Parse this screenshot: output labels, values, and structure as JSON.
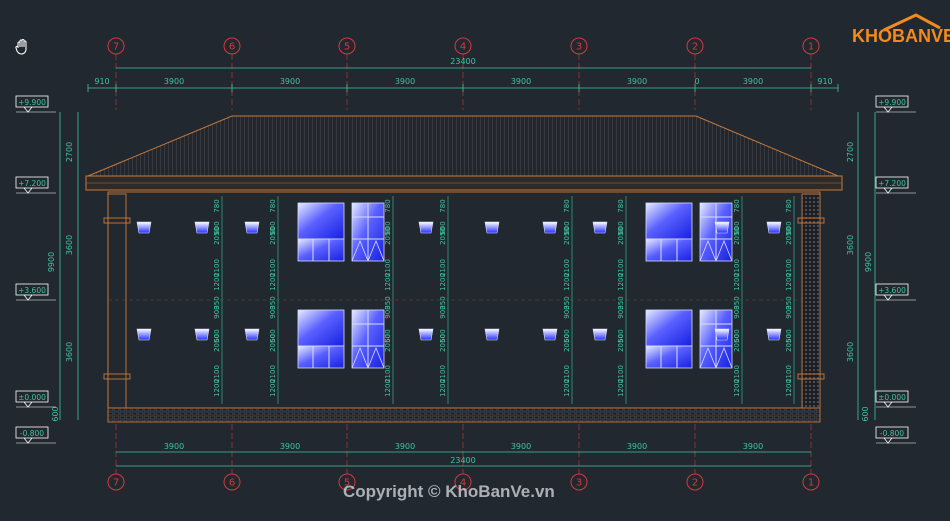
{
  "grid_axes": {
    "top": [
      "7",
      "6",
      "5",
      "4",
      "3",
      "2",
      "1"
    ],
    "bottom": [
      "7",
      "6",
      "5",
      "4",
      "3",
      "2",
      "1"
    ]
  },
  "dims_top": {
    "total": "23400",
    "segments": [
      "910",
      "3900",
      "3900",
      "3900",
      "3900",
      "3900",
      "0",
      "3900",
      "910"
    ]
  },
  "dims_bottom": {
    "total": "23400",
    "segments": [
      "3900",
      "3900",
      "3900",
      "3900",
      "3900",
      "3900"
    ]
  },
  "levels_left": [
    "+9.900",
    "+7.200",
    "+3.600",
    "±0.000",
    "-0.800"
  ],
  "levels_right": [
    "+9.900",
    "+7.200",
    "+3.600",
    "±0.000",
    "-0.800"
  ],
  "vert_dims_left": [
    "2700",
    "9900",
    "3600",
    "3600",
    "600"
  ],
  "vert_dims_right": [
    "2700",
    "9900",
    "3600",
    "3600",
    "600"
  ],
  "window_dims": [
    "780",
    "600",
    "2050",
    "2100",
    "1200",
    "350",
    "900",
    "600",
    "2050",
    "2100",
    "1200"
  ],
  "logo": {
    "text": "KHOBANVE"
  },
  "watermark": {
    "text": "Copyright © KhoBanVe.vn"
  },
  "colors": {
    "background": "#212830",
    "dim_line": "#3fc4a0",
    "dim_text": "#3fc4a0",
    "axis_circle": "#d23a3a",
    "building_outline": "#c87a3a",
    "window_blue": "#2b3cff",
    "roof": "#2a2d33",
    "brand": "#f28a1c"
  }
}
